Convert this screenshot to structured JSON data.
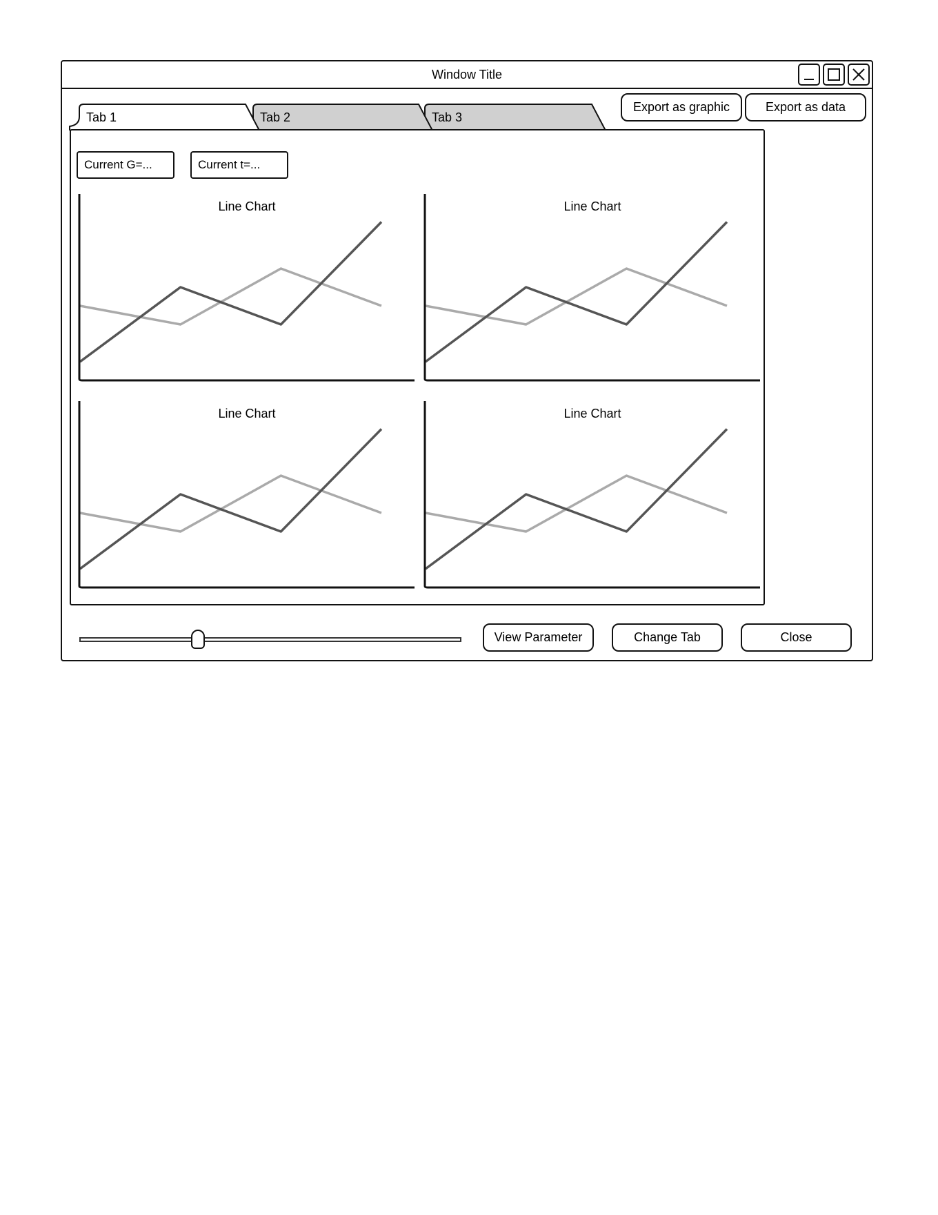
{
  "window": {
    "title": "Window Title",
    "controls": [
      "minimize-icon",
      "maximize-icon",
      "close-icon"
    ]
  },
  "tabs": [
    {
      "label": "Tab 1",
      "active": true
    },
    {
      "label": "Tab 2",
      "active": false
    },
    {
      "label": "Tab 3",
      "active": false
    }
  ],
  "export": {
    "graphic_label": "Export as graphic",
    "data_label": "Export as data"
  },
  "fields": {
    "g_label": "Current G=...",
    "t_label": "Current t=..."
  },
  "colors": {
    "series_dark": "#555555",
    "series_light": "#aaaaaa",
    "tab_inactive": "#d0d0d0"
  },
  "chart_data": [
    {
      "type": "line",
      "title": "Line Chart",
      "x": [
        0,
        1,
        2,
        3
      ],
      "ylim": [
        0,
        100
      ],
      "series": [
        {
          "values": [
            10,
            50,
            30,
            85
          ]
        },
        {
          "values": [
            40,
            30,
            60,
            40
          ]
        }
      ]
    },
    {
      "type": "line",
      "title": "Line Chart",
      "x": [
        0,
        1,
        2,
        3
      ],
      "ylim": [
        0,
        100
      ],
      "series": [
        {
          "values": [
            10,
            50,
            30,
            85
          ]
        },
        {
          "values": [
            40,
            30,
            60,
            40
          ]
        }
      ]
    },
    {
      "type": "line",
      "title": "Line Chart",
      "x": [
        0,
        1,
        2,
        3
      ],
      "ylim": [
        0,
        100
      ],
      "series": [
        {
          "values": [
            10,
            50,
            30,
            85
          ]
        },
        {
          "values": [
            40,
            30,
            60,
            40
          ]
        }
      ]
    },
    {
      "type": "line",
      "title": "Line Chart",
      "x": [
        0,
        1,
        2,
        3
      ],
      "ylim": [
        0,
        100
      ],
      "series": [
        {
          "values": [
            10,
            50,
            30,
            85
          ]
        },
        {
          "values": [
            40,
            30,
            60,
            40
          ]
        }
      ]
    }
  ],
  "slider": {
    "value": 0.31
  },
  "actions": {
    "view_parameter_label": "View Parameter",
    "change_tab_label": "Change Tab",
    "close_label": "Close"
  }
}
